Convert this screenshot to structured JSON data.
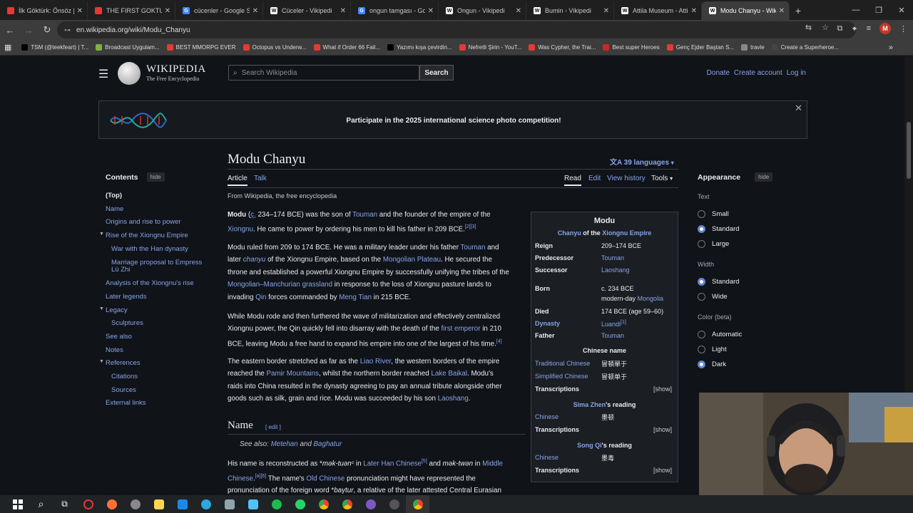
{
  "browser": {
    "tabs": [
      {
        "title": "İlk Göktürk: Önsöz | İl",
        "color": "#e53935"
      },
      {
        "title": "THE FIRST GOKTURK",
        "color": "#e53935"
      },
      {
        "title": "cücenler - Google Se",
        "color": "#4285f4"
      },
      {
        "title": "Cüceler - Vikipedi",
        "color": "#ffffff"
      },
      {
        "title": "ongun tamgası - Goo",
        "color": "#4285f4"
      },
      {
        "title": "Ongun - Vikipedi",
        "color": "#ffffff"
      },
      {
        "title": "Bumin - Vikipedi",
        "color": "#ffffff"
      },
      {
        "title": "Attila Museum - Atti",
        "color": "#ffffff"
      },
      {
        "title": "Modu Chanyu - Wiki",
        "color": "#ffffff"
      }
    ],
    "active_tab": 8,
    "url": "en.wikipedia.org/wiki/Modu_Chanyu",
    "profile_initial": "M",
    "bookmarks": [
      {
        "label": "TSM (@teekfeart) | T...",
        "color": "#000000"
      },
      {
        "label": "Broadcast Uygulam...",
        "color": "#7cb342"
      },
      {
        "label": "BEST MMORPG EVER",
        "color": "#e53935"
      },
      {
        "label": "Octopus vs Underw...",
        "color": "#e53935"
      },
      {
        "label": "What if Order 66 Fail...",
        "color": "#e53935"
      },
      {
        "label": "Yazımı kışa çevirdin...",
        "color": "#000000"
      },
      {
        "label": "Nefretli Şirin - YouT...",
        "color": "#e53935"
      },
      {
        "label": "Was Cypher, the Trai...",
        "color": "#e53935"
      },
      {
        "label": "Best super Heroes",
        "color": "#c62828"
      },
      {
        "label": "Genç Ejder Baştan S...",
        "color": "#e53935"
      },
      {
        "label": "travle",
        "color": "#888888"
      },
      {
        "label": "Create a Superheroe...",
        "color": "#444444"
      }
    ]
  },
  "wiki": {
    "wordmark": "WIKIPEDIA",
    "tagline": "The Free Encyclopedia",
    "search_placeholder": "Search Wikipedia",
    "search_button": "Search",
    "donate": "Donate",
    "create_account": "Create account",
    "login": "Log in",
    "banner_text": "Participate in the 2025 international science photo competition!",
    "title": "Modu Chanyu",
    "languages": "39 languages",
    "tab_article": "Article",
    "tab_talk": "Talk",
    "tab_read": "Read",
    "tab_edit": "Edit",
    "tab_history": "View history",
    "tab_tools": "Tools",
    "from_line": "From Wikipedia, the free encyclopedia",
    "section_name": "Name",
    "section_edit": "[ edit ]"
  },
  "toc": {
    "heading": "Contents",
    "hide": "hide",
    "items": [
      {
        "label": "(Top)"
      },
      {
        "label": "Name"
      },
      {
        "label": "Origins and rise to power"
      },
      {
        "label": "Rise of the Xiongnu Empire"
      },
      {
        "label": "War with the Han dynasty"
      },
      {
        "label": "Marriage proposal to Empress"
      },
      {
        "label": "Lü Zhi"
      },
      {
        "label": "Analysis of the Xiongnu's rise"
      },
      {
        "label": "Later legends"
      },
      {
        "label": "Legacy"
      },
      {
        "label": "Sculptures"
      },
      {
        "label": "See also"
      },
      {
        "label": "Notes"
      },
      {
        "label": "References"
      },
      {
        "label": "Citations"
      },
      {
        "label": "Sources"
      },
      {
        "label": "External links"
      }
    ]
  },
  "article": {
    "p1": {
      "a": "Modu",
      "b": " (",
      "c": "c.",
      "d": " 234–174 BCE) was the son of ",
      "e": "Touman",
      "f": " and the founder of the empire of the",
      "g": "Xiongnu",
      "h": ". He came to power by ordering his men to kill his father in 209 BCE.",
      "i": "[2][3]"
    },
    "p2": {
      "a": "Modu ruled from 209 to 174 BCE. He was a military leader under his father ",
      "b": "Touman",
      "c": " and",
      "d": "later ",
      "e": "chanyu",
      "f": " of the Xiongnu Empire, based on the ",
      "g": "Mongolian Plateau",
      "h": ". He secured the",
      "i": "throne and established a powerful Xiongnu Empire by successfully unifying the tribes of the",
      "j": "Mongolian–Manchurian grassland",
      "k": " in response to the loss of Xiongnu pasture lands to",
      "l": "invading ",
      "m": "Qin",
      "n": " forces commanded by ",
      "o": "Meng Tian",
      "p": " in 215 BCE."
    },
    "p3": {
      "a": "While Modu rode and then furthered the wave of militarization and effectively centralized",
      "b": "Xiongnu power, the Qin quickly fell into disarray with the death of the ",
      "c": "first emperor",
      "d": " in 210",
      "e": "BCE, leaving Modu a free hand to expand his empire into one of the largest of his time.",
      "f": "[4]"
    },
    "p4": {
      "a": "The eastern border stretched as far as the ",
      "b": "Liao River",
      "c": ", the western borders of the empire",
      "d": "reached the ",
      "e": "Pamir Mountains",
      "f": ", whilst the northern border reached ",
      "g": "Lake Baikal",
      "h": ". Modu's",
      "i": "raids into China resulted in the dynasty agreeing to pay an annual tribute alongside other",
      "j": "goods such as silk, grain and rice. Modu was succeeded by his son ",
      "k": "Laoshang",
      "l": "."
    },
    "see_also": {
      "a": "See also: ",
      "b": "Metehan",
      "c": " and ",
      "d": "Baghatur"
    },
    "p5": {
      "a": "His name is reconstructed as *",
      "b": "mək-tuənᶜ",
      "c": " in ",
      "d": "Later Han Chinese",
      "e": "[5]",
      "f": " and ",
      "g": "mək-twən",
      "h": " in ",
      "i": "Middle",
      "j": "Chinese",
      "k": ".",
      "l": "[a][6]",
      "m": " The name's ",
      "n": "Old Chinese",
      "o": " pronunciation might have represented the",
      "p": "pronunciation of the foreign word *",
      "q": "baγtur",
      "r": ", a relative of the later attested Central Eurasian"
    }
  },
  "infobox": {
    "title": "Modu",
    "sub_a": "Chanyu",
    "sub_b": " of the ",
    "sub_c": "Xiongnu Empire",
    "reign_l": "Reign",
    "reign_v": "209–174 BCE",
    "pred_l": "Predecessor",
    "pred_v": "Touman",
    "succ_l": "Successor",
    "succ_v": "Laoshang",
    "born_l": "Born",
    "born_v1": "c. 234 BCE",
    "born_v2a": "modern-day ",
    "born_v2b": "Mongolia",
    "died_l": "Died",
    "died_v": "174 BCE (age 59–60)",
    "dyn_l": "Dynasty",
    "dyn_v": "Luandi",
    "dyn_sup": "[1]",
    "father_l": "Father",
    "father_v": "Touman",
    "cn_head": "Chinese name",
    "trad_l": "Traditional Chinese",
    "trad_v": "冒頓單于",
    "simp_l": "Simplified Chinese",
    "simp_v": "冒顿单于",
    "trans": "Transcriptions",
    "show": "[show]",
    "sima_a": "Sima Zhen",
    "sima_b": "'s reading",
    "chinese": "Chinese",
    "sima_v": "墨顿",
    "song_a": "Song Qi",
    "song_b": "'s reading",
    "song_v": "墨毒"
  },
  "appearance": {
    "heading": "Appearance",
    "hide": "hide",
    "text_group": "Text",
    "text_options": [
      "Small",
      "Standard",
      "Large"
    ],
    "text_selected": "Standard",
    "width_group": "Width",
    "width_options": [
      "Standard",
      "Wide"
    ],
    "width_selected": "Standard",
    "color_group": "Color (beta)",
    "color_options": [
      "Automatic",
      "Light",
      "Dark"
    ],
    "color_selected": "Dark"
  }
}
